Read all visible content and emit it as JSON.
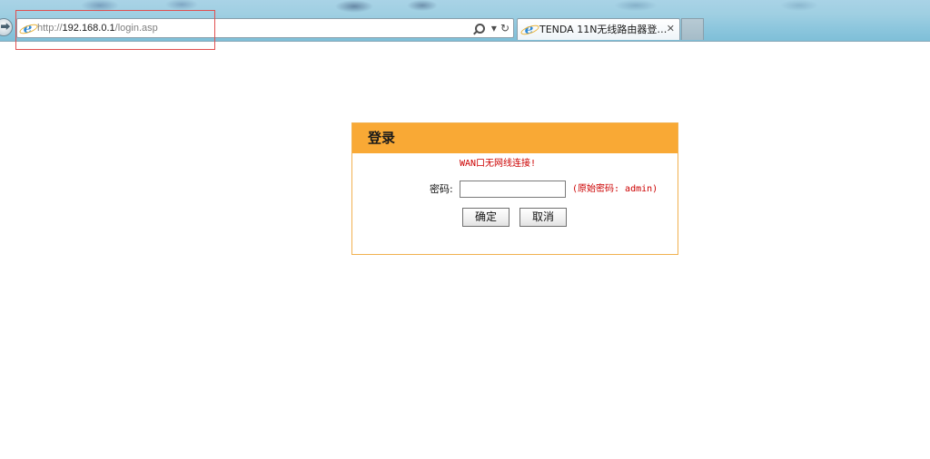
{
  "browser": {
    "url_prefix": "http://",
    "url_host": "192.168.0.1",
    "url_path": "/login.asp",
    "tab_title": "TENDA 11N无线路由器登…",
    "tab_close": "✕",
    "address_dropdown": "▾",
    "refresh_glyph": "↻",
    "back_glyph": "⮕"
  },
  "login": {
    "title": "登录",
    "warning": "WAN口无网线连接!",
    "password_label": "密码:",
    "password_value": "",
    "password_hint": "(原始密码: admin)",
    "ok_label": "确定",
    "cancel_label": "取消"
  },
  "colors": {
    "header_orange": "#f9a935",
    "panel_border": "#f1b14f",
    "warning_red": "#cc0000",
    "annotation_red": "#e05050"
  }
}
